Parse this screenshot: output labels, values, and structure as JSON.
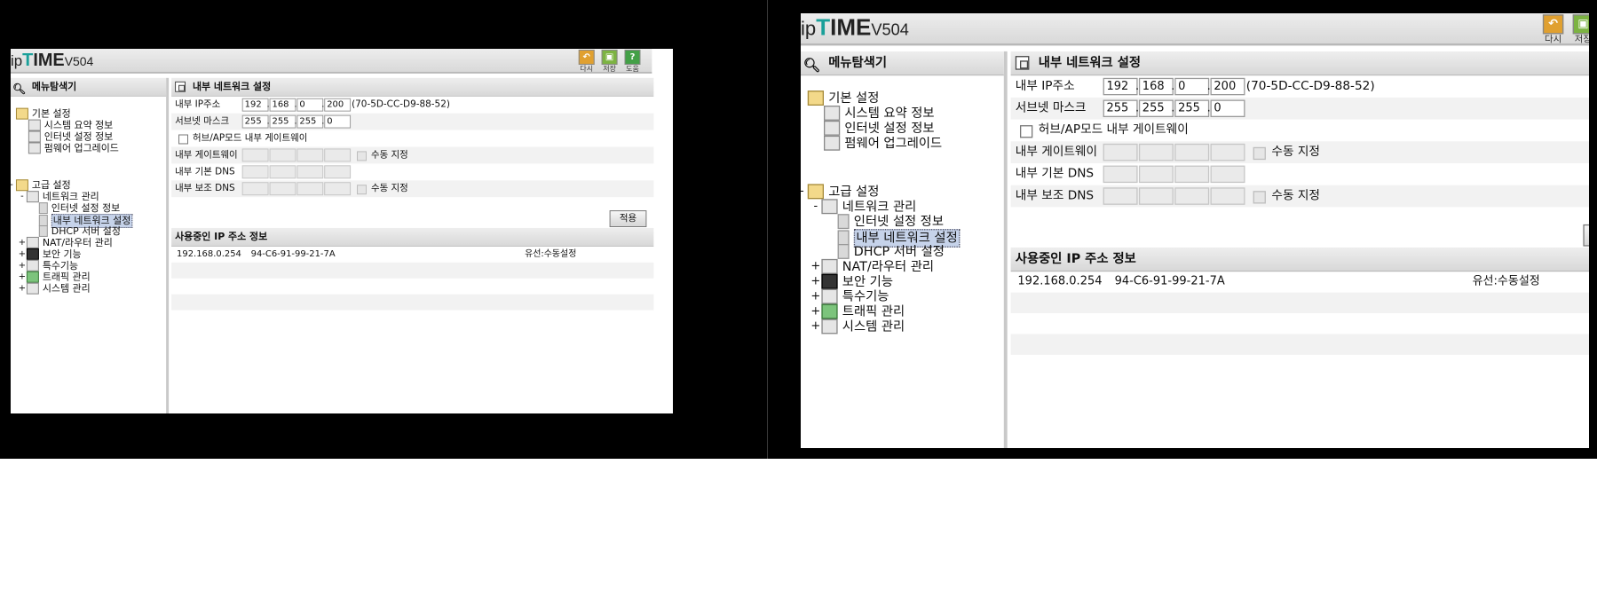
{
  "brand": {
    "prefix": "ip",
    "t": "T",
    "rest": "IME",
    "version": "V504"
  },
  "toolbar": {
    "buttons": [
      {
        "label": "다시",
        "icon": "undo-icon",
        "color": "#e0a030"
      },
      {
        "label": "저장",
        "icon": "save-icon",
        "color": "#7cb342"
      },
      {
        "label": "도움",
        "icon": "help-icon",
        "color": "#43a047",
        "glyph": "?"
      }
    ]
  },
  "sidebar": {
    "title": "메뉴탐색기",
    "basic": {
      "label": "기본 설정",
      "items": [
        "시스템 요약 정보",
        "인터넷 설정 정보",
        "펌웨어 업그레이드"
      ]
    },
    "advanced": {
      "label": "고급 설정",
      "network": {
        "label": "네트워크 관리",
        "items": [
          "인터넷 설정 정보",
          "내부 네트워크 설정",
          "DHCP 서버 설정"
        ]
      },
      "groups": [
        "NAT/라우터 관리",
        "보안 기능",
        "특수기능",
        "트래픽 관리",
        "시스템 관리"
      ]
    },
    "expand": {
      "open": "-",
      "closed": "+"
    }
  },
  "main": {
    "title": "내부 네트워크 설정",
    "ip_label": "내부 IP주소",
    "ip": [
      "192",
      "168",
      "0",
      "200"
    ],
    "mac": "(70-5D-CC-D9-88-52)",
    "subnet_label": "서브넷 마스크",
    "subnet": [
      "255",
      "255",
      "255",
      "0"
    ],
    "hub_ap_label": "허브/AP모드 내부 게이트웨이",
    "gateway_label": "내부 게이트웨이",
    "dns1_label": "내부 기본 DNS",
    "dns2_label": "내부 보조 DNS",
    "manual_label": "수동 지정",
    "apply_label": "적용",
    "in_use_title": "사용중인 IP 주소 정보",
    "in_use": [
      {
        "ip": "192.168.0.254",
        "mac": "94-C6-91-99-21-7A",
        "type": "유선:수동설정"
      }
    ]
  }
}
